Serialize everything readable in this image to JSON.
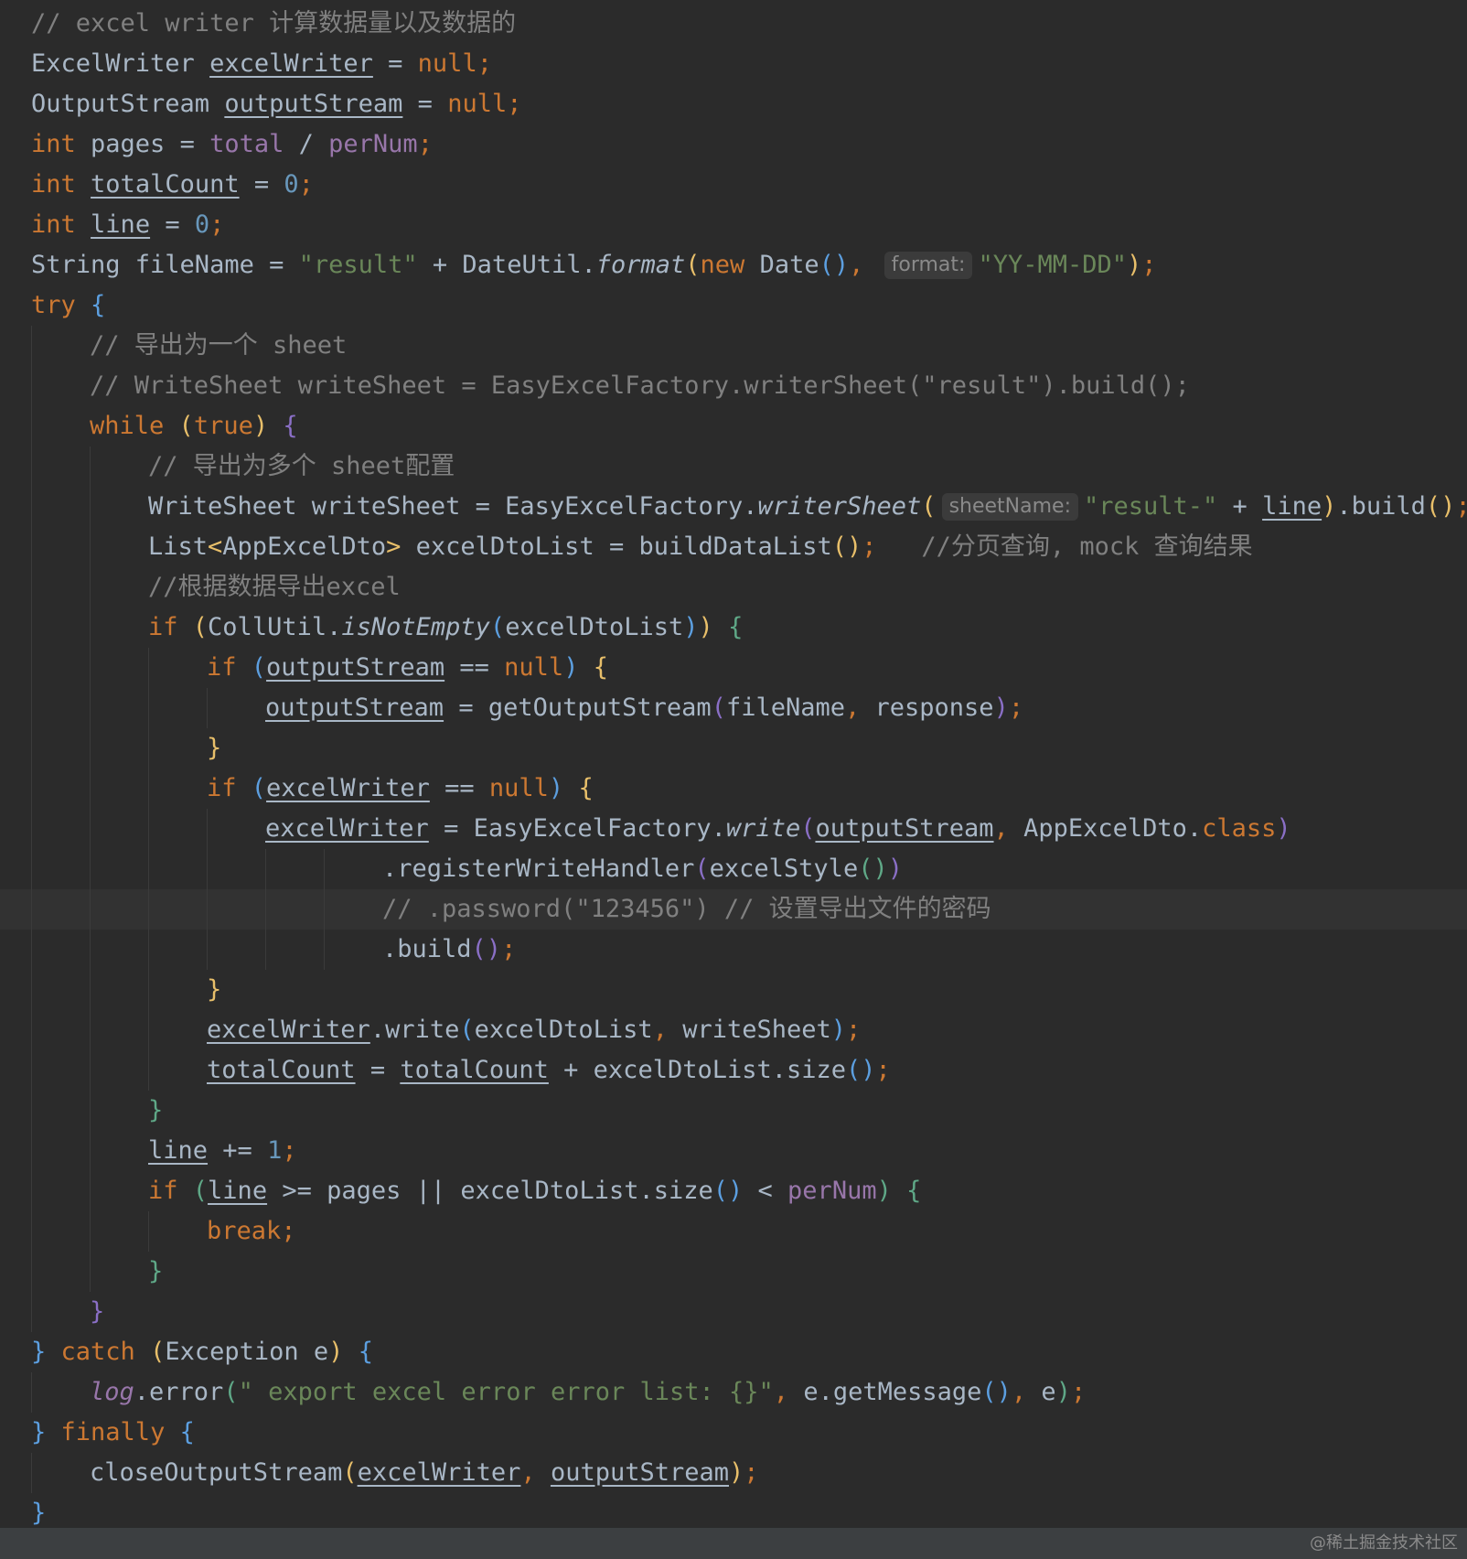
{
  "editor": {
    "current_line": 22,
    "lines": [
      {
        "indent": 0,
        "tokens": [
          {
            "t": "// excel writer 计算数据量以及数据的",
            "s": "com"
          }
        ]
      },
      {
        "indent": 0,
        "tokens": [
          {
            "t": "ExcelWriter ",
            "s": "plain"
          },
          {
            "t": "excelWriter",
            "s": "u"
          },
          {
            "t": " = ",
            "s": "plain"
          },
          {
            "t": "null",
            "s": "kw"
          },
          {
            "t": ";",
            "s": "kw"
          }
        ]
      },
      {
        "indent": 0,
        "tokens": [
          {
            "t": "OutputStream ",
            "s": "plain"
          },
          {
            "t": "outputStream",
            "s": "u"
          },
          {
            "t": " = ",
            "s": "plain"
          },
          {
            "t": "null",
            "s": "kw"
          },
          {
            "t": ";",
            "s": "kw"
          }
        ]
      },
      {
        "indent": 0,
        "tokens": [
          {
            "t": "int",
            "s": "kw"
          },
          {
            "t": " pages = ",
            "s": "plain"
          },
          {
            "t": "total",
            "s": "field"
          },
          {
            "t": " / ",
            "s": "plain"
          },
          {
            "t": "perNum",
            "s": "field"
          },
          {
            "t": ";",
            "s": "kw"
          }
        ]
      },
      {
        "indent": 0,
        "tokens": [
          {
            "t": "int",
            "s": "kw"
          },
          {
            "t": " ",
            "s": "plain"
          },
          {
            "t": "totalCount",
            "s": "u"
          },
          {
            "t": " = ",
            "s": "plain"
          },
          {
            "t": "0",
            "s": "num"
          },
          {
            "t": ";",
            "s": "kw"
          }
        ]
      },
      {
        "indent": 0,
        "tokens": [
          {
            "t": "int",
            "s": "kw"
          },
          {
            "t": " ",
            "s": "plain"
          },
          {
            "t": "line",
            "s": "u"
          },
          {
            "t": " = ",
            "s": "plain"
          },
          {
            "t": "0",
            "s": "num"
          },
          {
            "t": ";",
            "s": "kw"
          }
        ]
      },
      {
        "indent": 0,
        "tokens": [
          {
            "t": "String fileName = ",
            "s": "plain"
          },
          {
            "t": "\"result\"",
            "s": "str"
          },
          {
            "t": " + DateUtil.",
            "s": "plain"
          },
          {
            "t": "format",
            "s": "ital"
          },
          {
            "t": "(",
            "s": "b1"
          },
          {
            "t": "new",
            "s": "kw"
          },
          {
            "t": " Date",
            "s": "plain"
          },
          {
            "t": "()",
            "s": "b2"
          },
          {
            "t": ", ",
            "s": "kw"
          },
          {
            "t": "format:",
            "s": "hint"
          },
          {
            "t": "\"YY-MM-DD\"",
            "s": "str"
          },
          {
            "t": ")",
            "s": "b1"
          },
          {
            "t": ";",
            "s": "kw"
          }
        ]
      },
      {
        "indent": 0,
        "tokens": [
          {
            "t": "try",
            "s": "kw"
          },
          {
            "t": " ",
            "s": "plain"
          },
          {
            "t": "{",
            "s": "b2"
          }
        ]
      },
      {
        "indent": 1,
        "tokens": [
          {
            "t": "// 导出为一个 sheet",
            "s": "com"
          }
        ]
      },
      {
        "indent": 1,
        "tokens": [
          {
            "t": "// WriteSheet writeSheet = EasyExcelFactory.writerSheet(\"result\").build();",
            "s": "com"
          }
        ]
      },
      {
        "indent": 1,
        "tokens": [
          {
            "t": "while",
            "s": "kw"
          },
          {
            "t": " ",
            "s": "plain"
          },
          {
            "t": "(",
            "s": "b1"
          },
          {
            "t": "true",
            "s": "kw"
          },
          {
            "t": ")",
            "s": "b1"
          },
          {
            "t": " ",
            "s": "plain"
          },
          {
            "t": "{",
            "s": "b4"
          }
        ]
      },
      {
        "indent": 2,
        "tokens": [
          {
            "t": "// 导出为多个 sheet配置",
            "s": "com"
          }
        ]
      },
      {
        "indent": 2,
        "tokens": [
          {
            "t": "WriteSheet writeSheet = EasyExcelFactory.",
            "s": "plain"
          },
          {
            "t": "writerSheet",
            "s": "ital"
          },
          {
            "t": "(",
            "s": "b1"
          },
          {
            "t": "sheetName:",
            "s": "hint"
          },
          {
            "t": "\"result-\"",
            "s": "str"
          },
          {
            "t": " + ",
            "s": "plain"
          },
          {
            "t": "line",
            "s": "u"
          },
          {
            "t": ")",
            "s": "b1"
          },
          {
            "t": ".build",
            "s": "plain"
          },
          {
            "t": "()",
            "s": "b1"
          },
          {
            "t": ";",
            "s": "kw"
          }
        ]
      },
      {
        "indent": 2,
        "tokens": [
          {
            "t": "List",
            "s": "plain"
          },
          {
            "t": "<",
            "s": "b1"
          },
          {
            "t": "AppExcelDto",
            "s": "plain"
          },
          {
            "t": ">",
            "s": "b1"
          },
          {
            "t": " excelDtoList = buildDataList",
            "s": "plain"
          },
          {
            "t": "()",
            "s": "b1"
          },
          {
            "t": ";",
            "s": "kw"
          },
          {
            "t": "   //分页查询, mock 查询结果",
            "s": "com"
          }
        ]
      },
      {
        "indent": 2,
        "tokens": [
          {
            "t": "//根据数据导出excel",
            "s": "com"
          }
        ]
      },
      {
        "indent": 2,
        "tokens": [
          {
            "t": "if",
            "s": "kw"
          },
          {
            "t": " ",
            "s": "plain"
          },
          {
            "t": "(",
            "s": "b1"
          },
          {
            "t": "CollUtil.",
            "s": "plain"
          },
          {
            "t": "isNotEmpty",
            "s": "ital"
          },
          {
            "t": "(",
            "s": "b2"
          },
          {
            "t": "excelDtoList",
            "s": "plain"
          },
          {
            "t": ")",
            "s": "b2"
          },
          {
            "t": ")",
            "s": "b1"
          },
          {
            "t": " ",
            "s": "plain"
          },
          {
            "t": "{",
            "s": "b3"
          }
        ]
      },
      {
        "indent": 3,
        "tokens": [
          {
            "t": "if",
            "s": "kw"
          },
          {
            "t": " ",
            "s": "plain"
          },
          {
            "t": "(",
            "s": "b2"
          },
          {
            "t": "outputStream",
            "s": "u"
          },
          {
            "t": " == ",
            "s": "plain"
          },
          {
            "t": "null",
            "s": "kw"
          },
          {
            "t": ")",
            "s": "b2"
          },
          {
            "t": " ",
            "s": "plain"
          },
          {
            "t": "{",
            "s": "b1"
          }
        ]
      },
      {
        "indent": 4,
        "tokens": [
          {
            "t": "outputStream",
            "s": "u"
          },
          {
            "t": " = getOutputStream",
            "s": "plain"
          },
          {
            "t": "(",
            "s": "b4"
          },
          {
            "t": "fileName",
            "s": "plain"
          },
          {
            "t": ", ",
            "s": "kw"
          },
          {
            "t": "response",
            "s": "plain"
          },
          {
            "t": ")",
            "s": "b4"
          },
          {
            "t": ";",
            "s": "kw"
          }
        ]
      },
      {
        "indent": 3,
        "tokens": [
          {
            "t": "}",
            "s": "b1"
          }
        ]
      },
      {
        "indent": 3,
        "tokens": [
          {
            "t": "if",
            "s": "kw"
          },
          {
            "t": " ",
            "s": "plain"
          },
          {
            "t": "(",
            "s": "b2"
          },
          {
            "t": "excelWriter",
            "s": "u"
          },
          {
            "t": " == ",
            "s": "plain"
          },
          {
            "t": "null",
            "s": "kw"
          },
          {
            "t": ")",
            "s": "b2"
          },
          {
            "t": " ",
            "s": "plain"
          },
          {
            "t": "{",
            "s": "b1"
          }
        ]
      },
      {
        "indent": 4,
        "tokens": [
          {
            "t": "excelWriter",
            "s": "u"
          },
          {
            "t": " = EasyExcelFactory.",
            "s": "plain"
          },
          {
            "t": "write",
            "s": "ital"
          },
          {
            "t": "(",
            "s": "b4"
          },
          {
            "t": "outputStream",
            "s": "u"
          },
          {
            "t": ", ",
            "s": "kw"
          },
          {
            "t": "AppExcelDto.",
            "s": "plain"
          },
          {
            "t": "class",
            "s": "kw"
          },
          {
            "t": ")",
            "s": "b4"
          }
        ]
      },
      {
        "indent": 6,
        "tokens": [
          {
            "t": ".registerWriteHandler",
            "s": "plain"
          },
          {
            "t": "(",
            "s": "b4"
          },
          {
            "t": "excelStyle",
            "s": "plain"
          },
          {
            "t": "()",
            "s": "b3"
          },
          {
            "t": ")",
            "s": "b4"
          }
        ]
      },
      {
        "indent": 6,
        "tokens": [
          {
            "t": "// .password(\"123456\") // 设置导出文件的密码",
            "s": "com"
          }
        ]
      },
      {
        "indent": 6,
        "tokens": [
          {
            "t": ".build",
            "s": "plain"
          },
          {
            "t": "()",
            "s": "b4"
          },
          {
            "t": ";",
            "s": "kw"
          }
        ]
      },
      {
        "indent": 3,
        "tokens": [
          {
            "t": "}",
            "s": "b1"
          }
        ]
      },
      {
        "indent": 3,
        "tokens": [
          {
            "t": "excelWriter",
            "s": "u"
          },
          {
            "t": ".write",
            "s": "plain"
          },
          {
            "t": "(",
            "s": "b2"
          },
          {
            "t": "excelDtoList",
            "s": "plain"
          },
          {
            "t": ", ",
            "s": "kw"
          },
          {
            "t": "writeSheet",
            "s": "plain"
          },
          {
            "t": ")",
            "s": "b2"
          },
          {
            "t": ";",
            "s": "kw"
          }
        ]
      },
      {
        "indent": 3,
        "tokens": [
          {
            "t": "totalCount",
            "s": "u"
          },
          {
            "t": " = ",
            "s": "plain"
          },
          {
            "t": "totalCount",
            "s": "u"
          },
          {
            "t": " + excelDtoList.size",
            "s": "plain"
          },
          {
            "t": "()",
            "s": "b2"
          },
          {
            "t": ";",
            "s": "kw"
          }
        ]
      },
      {
        "indent": 2,
        "tokens": [
          {
            "t": "}",
            "s": "b3"
          }
        ]
      },
      {
        "indent": 2,
        "tokens": [
          {
            "t": "line",
            "s": "u"
          },
          {
            "t": " += ",
            "s": "plain"
          },
          {
            "t": "1",
            "s": "num"
          },
          {
            "t": ";",
            "s": "kw"
          }
        ]
      },
      {
        "indent": 2,
        "tokens": [
          {
            "t": "if",
            "s": "kw"
          },
          {
            "t": " ",
            "s": "plain"
          },
          {
            "t": "(",
            "s": "b3"
          },
          {
            "t": "line",
            "s": "u"
          },
          {
            "t": " >= pages || excelDtoList.size",
            "s": "plain"
          },
          {
            "t": "()",
            "s": "b2"
          },
          {
            "t": " < ",
            "s": "plain"
          },
          {
            "t": "perNum",
            "s": "field"
          },
          {
            "t": ")",
            "s": "b3"
          },
          {
            "t": " ",
            "s": "plain"
          },
          {
            "t": "{",
            "s": "b3"
          }
        ]
      },
      {
        "indent": 3,
        "tokens": [
          {
            "t": "break",
            "s": "kw"
          },
          {
            "t": ";",
            "s": "kw"
          }
        ]
      },
      {
        "indent": 2,
        "tokens": [
          {
            "t": "}",
            "s": "b3"
          }
        ]
      },
      {
        "indent": 1,
        "tokens": [
          {
            "t": "}",
            "s": "b4"
          }
        ]
      },
      {
        "indent": 0,
        "tokens": [
          {
            "t": "}",
            "s": "b2"
          },
          {
            "t": " ",
            "s": "plain"
          },
          {
            "t": "catch",
            "s": "kw"
          },
          {
            "t": " ",
            "s": "plain"
          },
          {
            "t": "(",
            "s": "b1"
          },
          {
            "t": "Exception e",
            "s": "plain"
          },
          {
            "t": ")",
            "s": "b1"
          },
          {
            "t": " ",
            "s": "plain"
          },
          {
            "t": "{",
            "s": "b2"
          }
        ]
      },
      {
        "indent": 1,
        "tokens": [
          {
            "t": "log",
            "s": "log"
          },
          {
            "t": ".error",
            "s": "plain"
          },
          {
            "t": "(",
            "s": "b3"
          },
          {
            "t": "\" export excel error error list: {}\"",
            "s": "str"
          },
          {
            "t": ", ",
            "s": "kw"
          },
          {
            "t": "e.getMessage",
            "s": "plain"
          },
          {
            "t": "()",
            "s": "b2"
          },
          {
            "t": ", ",
            "s": "kw"
          },
          {
            "t": "e",
            "s": "plain"
          },
          {
            "t": ")",
            "s": "b3"
          },
          {
            "t": ";",
            "s": "kw"
          }
        ]
      },
      {
        "indent": 0,
        "tokens": [
          {
            "t": "}",
            "s": "b2"
          },
          {
            "t": " ",
            "s": "plain"
          },
          {
            "t": "finally",
            "s": "kw"
          },
          {
            "t": " ",
            "s": "plain"
          },
          {
            "t": "{",
            "s": "b2"
          }
        ]
      },
      {
        "indent": 1,
        "tokens": [
          {
            "t": "closeOutputStream",
            "s": "plain"
          },
          {
            "t": "(",
            "s": "b1"
          },
          {
            "t": "excelWriter",
            "s": "u"
          },
          {
            "t": ", ",
            "s": "kw"
          },
          {
            "t": "outputStream",
            "s": "u"
          },
          {
            "t": ")",
            "s": "b1"
          },
          {
            "t": ";",
            "s": "kw"
          }
        ]
      },
      {
        "indent": 0,
        "tokens": [
          {
            "t": "}",
            "s": "b2"
          }
        ]
      }
    ]
  },
  "footer": {
    "watermark": "@稀土掘金技术社区"
  },
  "colors": {
    "background": "#2b2b2b",
    "keyword": "#cc7832",
    "string": "#6a8759",
    "number": "#6897bb",
    "comment": "#808080",
    "field": "#9876aa"
  }
}
